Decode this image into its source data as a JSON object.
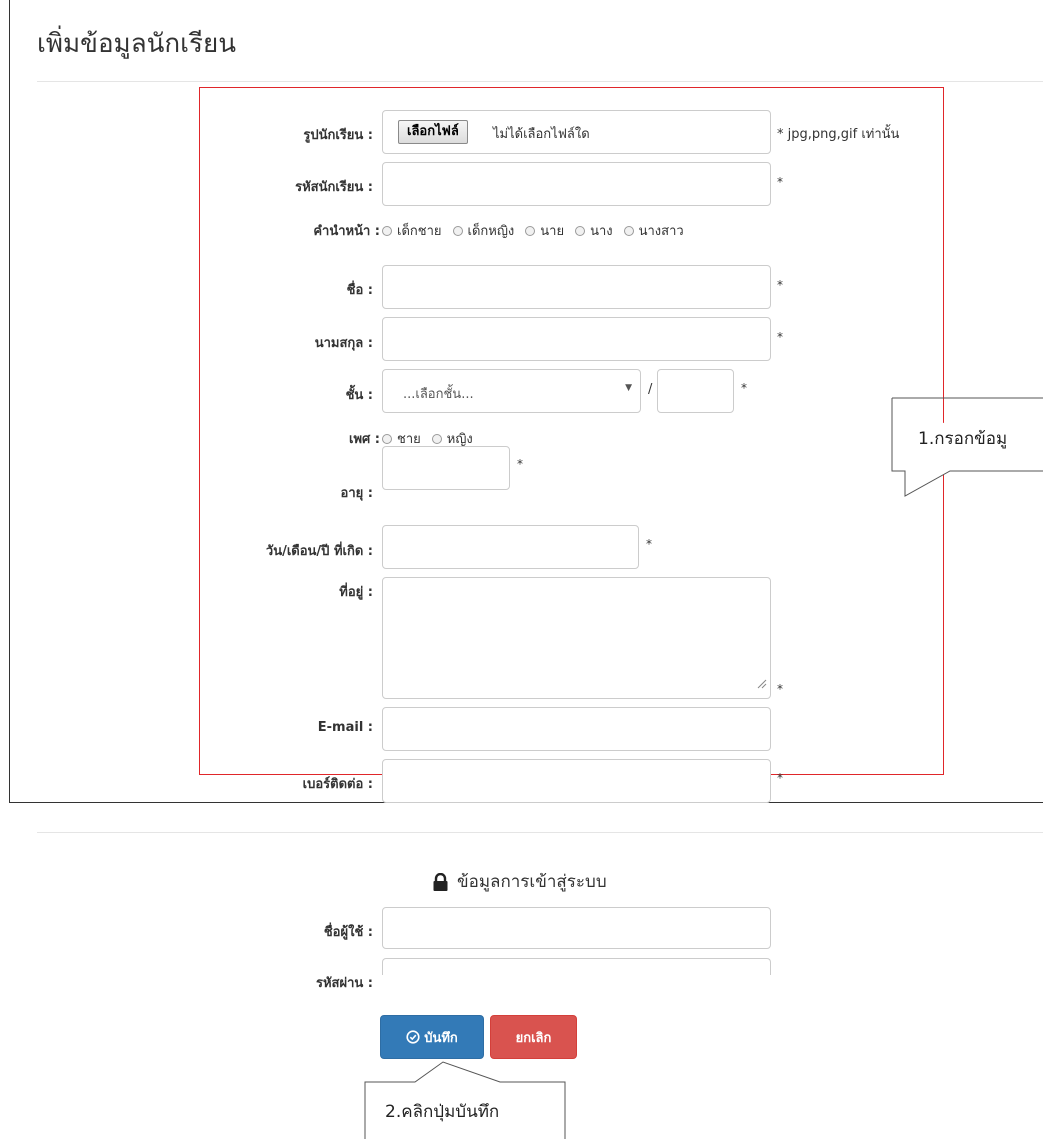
{
  "page": {
    "title": "เพิ่มข้อมูลนักเรียน"
  },
  "form": {
    "photo_label": "รูปนักเรียน :",
    "file_button": "เลือกไฟล์",
    "file_status": "ไม่ได้เลือกไฟล์ใด",
    "file_hint": "* jpg,png,gif เท่านั้น",
    "student_id_label": "รหัสนักเรียน :",
    "prefix_label": "คำนำหน้า :",
    "prefix_options": [
      "เด็กชาย",
      "เด็กหญิง",
      "นาย",
      "นาง",
      "นางสาว"
    ],
    "first_name_label": "ชื่อ :",
    "last_name_label": "นามสกุล :",
    "class_label": "ชั้น :",
    "class_select_value": "...เลือกชั้น...",
    "class_separator": "/",
    "gender_label": "เพศ :",
    "gender_options": [
      "ชาย",
      "หญิง"
    ],
    "age_label": "อายุ :",
    "birthdate_label": "วัน/เดือน/ปี ที่เกิด :",
    "address_label": "ที่อยู่ :",
    "email_label": "E-mail :",
    "phone_label": "เบอร์ติดต่อ :",
    "required_mark": "*"
  },
  "login_section": {
    "title": "ข้อมูลการเข้าสู่ระบบ",
    "username_label": "ชื่อผู้ใช้ :",
    "password_label": "รหัสผ่าน :"
  },
  "actions": {
    "save": "บันทึก",
    "cancel": "ยกเลิก"
  },
  "callouts": {
    "step1": "1.กรอกข้อมู",
    "step2": "2.คลิกปุ่มบันทึก"
  },
  "colors": {
    "primary": "#337ab7",
    "danger": "#d9534f",
    "highlight_border": "#e0262a"
  },
  "icons": {
    "save": "check-circle-icon",
    "section": "lock-icon"
  }
}
